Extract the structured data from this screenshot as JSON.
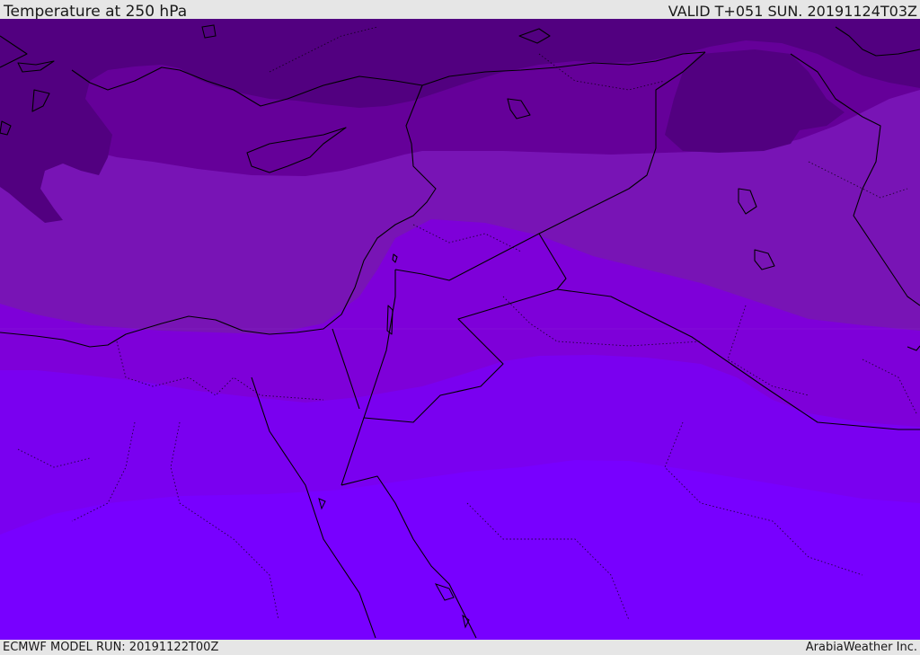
{
  "header": {
    "title": "Temperature at 250 hPa",
    "valid_time": "VALID T+051 SUN. 20191124T03Z"
  },
  "footer": {
    "model_run": "ECMWF MODEL RUN: 20191122T00Z",
    "credit": "ArabiaWeather Inc."
  },
  "map": {
    "variable": "temperature",
    "level": "250 hPa",
    "band_colors": [
      "#520080",
      "#650099",
      "#7814b5",
      "#7e00d9",
      "#7a00f0",
      "#7800ff"
    ],
    "border_color": "#000000"
  }
}
